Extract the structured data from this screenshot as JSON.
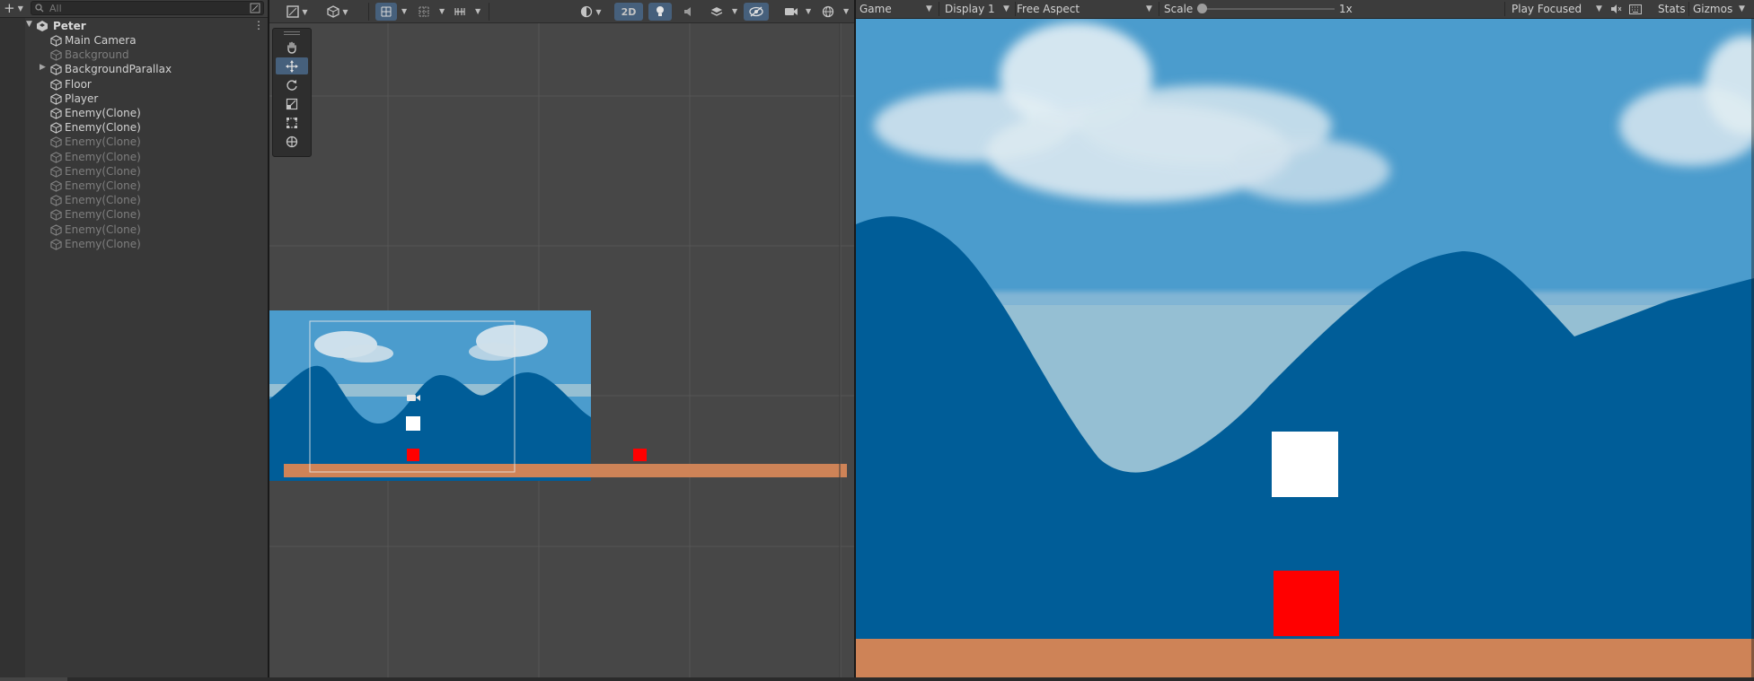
{
  "hierarchy": {
    "search_placeholder": "All",
    "scene_name": "Peter",
    "items": [
      {
        "label": "Main Camera",
        "dim": false,
        "expandable": false
      },
      {
        "label": "Background",
        "dim": true,
        "expandable": false
      },
      {
        "label": "BackgroundParallax",
        "dim": false,
        "expandable": true
      },
      {
        "label": "Floor",
        "dim": false,
        "expandable": false
      },
      {
        "label": "Player",
        "dim": false,
        "expandable": false
      },
      {
        "label": "Enemy(Clone)",
        "dim": false,
        "expandable": false
      },
      {
        "label": "Enemy(Clone)",
        "dim": false,
        "expandable": false
      },
      {
        "label": "Enemy(Clone)",
        "dim": true,
        "expandable": false
      },
      {
        "label": "Enemy(Clone)",
        "dim": true,
        "expandable": false
      },
      {
        "label": "Enemy(Clone)",
        "dim": true,
        "expandable": false
      },
      {
        "label": "Enemy(Clone)",
        "dim": true,
        "expandable": false
      },
      {
        "label": "Enemy(Clone)",
        "dim": true,
        "expandable": false
      },
      {
        "label": "Enemy(Clone)",
        "dim": true,
        "expandable": false
      },
      {
        "label": "Enemy(Clone)",
        "dim": true,
        "expandable": false
      },
      {
        "label": "Enemy(Clone)",
        "dim": true,
        "expandable": false
      }
    ]
  },
  "scene_toolbar": {
    "mode_2d_label": "2D"
  },
  "scene_tools": [
    "hand-tool",
    "move-tool",
    "rotate-tool",
    "scale-tool",
    "rect-tool",
    "transform-tool"
  ],
  "game_toolbar": {
    "view_label": "Game",
    "display_label": "Display 1",
    "aspect_label": "Free Aspect",
    "scale_label": "Scale",
    "scale_value": "1x",
    "scale_level": 0.0,
    "play_mode_label": "Play Focused",
    "stats_label": "Stats",
    "gizmos_label": "Gizmos"
  },
  "colors": {
    "sky": "#4b9ccd",
    "mountain": "#005d98",
    "haze": "#95bfd3",
    "floor": "#ce8357",
    "enemy": "#ff0000",
    "player": "#ffffff",
    "accent": "#46607c"
  }
}
